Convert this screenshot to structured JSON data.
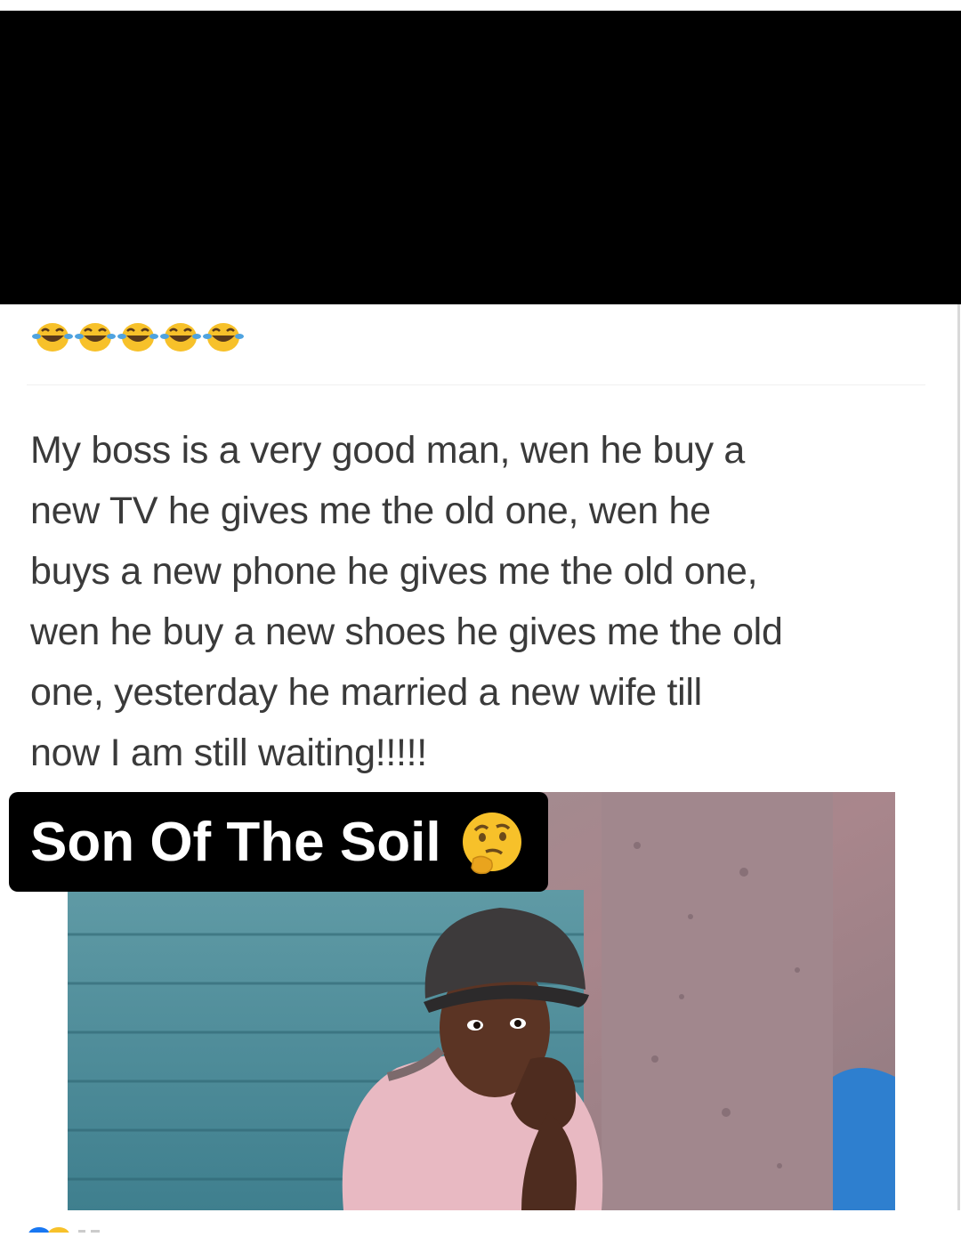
{
  "post": {
    "reaction_emojis": [
      "laughing-crying",
      "laughing-crying",
      "laughing-crying",
      "laughing-crying",
      "laughing-crying"
    ],
    "text_lines": [
      "My boss is a very good man, wen he buy a",
      "new TV he gives me the old one, wen he",
      "buys a new phone he gives me the old one,",
      "wen he buy a new shoes he gives me the old",
      "one, yesterday he married a new wife till",
      "now I am still waiting!!!!!"
    ]
  },
  "meme": {
    "caption": "Son Of The Soil",
    "caption_emoji": "thinking-face"
  },
  "colors": {
    "band": "#000000",
    "text": "#3a3a3a",
    "caption_bg": "#000000",
    "caption_text": "#ffffff",
    "emoji_yellow": "#f7c12a"
  }
}
